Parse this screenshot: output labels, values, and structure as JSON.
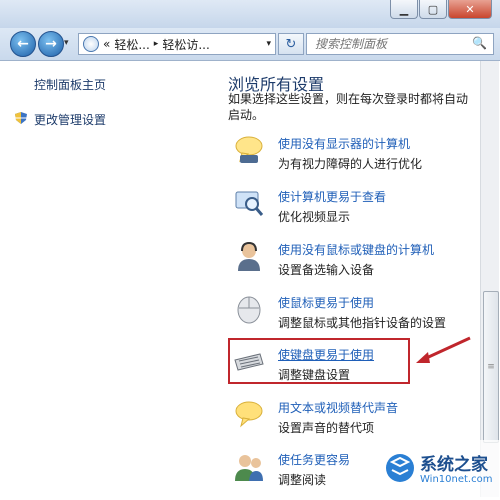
{
  "window": {
    "minimize_glyph": "▁",
    "maximize_glyph": "▢",
    "close_glyph": "✕"
  },
  "nav": {
    "back_glyph": "←",
    "forward_glyph": "→",
    "recent_glyph": "▾",
    "address_prefix": "«",
    "crumb1": "轻松...",
    "crumb_sep": "▸",
    "crumb2": "轻松访...",
    "address_dropdown": "▾",
    "refresh_glyph": "↻",
    "search_placeholder": "搜索控制面板",
    "search_icon": "🔍"
  },
  "sidebar": {
    "home": "控制面板主页",
    "admin_settings": "更改管理设置"
  },
  "main": {
    "heading": "浏览所有设置",
    "description": "如果选择这些设置，则在每次登录时都将自动启动。",
    "items": [
      {
        "title": "使用没有显示器的计算机",
        "subtitle": "为有视力障碍的人进行优化",
        "icon": "speech-bubble-icon"
      },
      {
        "title": "使计算机更易于查看",
        "subtitle": "优化视频显示",
        "icon": "magnifier-monitor-icon"
      },
      {
        "title": "使用没有鼠标或键盘的计算机",
        "subtitle": "设置备选输入设备",
        "icon": "user-headset-icon"
      },
      {
        "title": "使鼠标更易于使用",
        "subtitle": "调整鼠标或其他指针设备的设置",
        "icon": "mouse-icon"
      },
      {
        "title": "使键盘更易于使用",
        "subtitle": "调整键盘设置",
        "icon": "keyboard-icon"
      },
      {
        "title": "用文本或视频替代声音",
        "subtitle": "设置声音的替代项",
        "icon": "chat-bubble-icon"
      },
      {
        "title": "使任务更容易",
        "subtitle": "调整阅读",
        "icon": "user-group-icon"
      }
    ]
  },
  "watermark": {
    "brand": "系统之家",
    "url": "Win10net.com"
  },
  "colors": {
    "link": "#1f5fb8",
    "annotation": "#c0262c"
  }
}
